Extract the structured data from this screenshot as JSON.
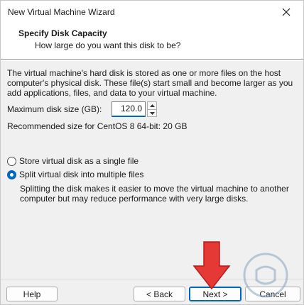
{
  "window": {
    "title": "New Virtual Machine Wizard"
  },
  "header": {
    "title": "Specify Disk Capacity",
    "subtitle": "How large do you want this disk to be?"
  },
  "description": "The virtual machine's hard disk is stored as one or more files on the host computer's physical disk. These file(s) start small and become larger as you add applications, files, and data to your virtual machine.",
  "disk_size": {
    "label": "Maximum disk size (GB):",
    "value": "120.0"
  },
  "recommended": "Recommended size for CentOS 8 64-bit: 20 GB",
  "options": [
    {
      "label": "Store virtual disk as a single file",
      "selected": false
    },
    {
      "label": "Split virtual disk into multiple files",
      "selected": true
    }
  ],
  "split_description": "Splitting the disk makes it easier to move the virtual machine to another computer but may reduce performance with very large disks.",
  "buttons": {
    "help": "Help",
    "back": "< Back",
    "next": "Next >",
    "cancel": "Cancel"
  },
  "colors": {
    "accent": "#0067c0",
    "arrow": "#e53935"
  }
}
